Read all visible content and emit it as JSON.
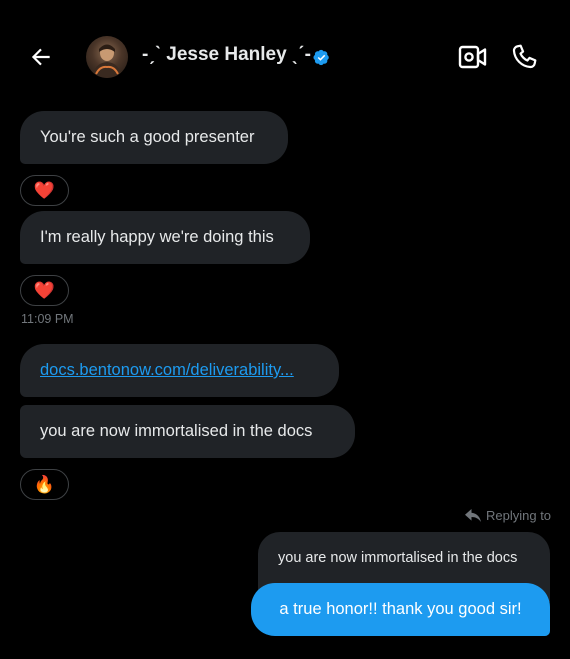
{
  "header": {
    "contact_name": "-ˏˋ Jesse Hanley ˎˊ-",
    "back_icon": "arrow-left-icon",
    "video_icon": "video-call-icon",
    "call_icon": "phone-icon",
    "verified_icon": "verified-badge-icon",
    "verified_color": "#1d9bf0"
  },
  "messages": [
    {
      "text": "You're such a good presenter",
      "reaction": "❤️"
    },
    {
      "text": "I'm really happy we're doing this",
      "reaction": "❤️"
    },
    {
      "timestamp": "11:09 PM"
    },
    {
      "link": "docs.bentonow.com/deliverability..."
    },
    {
      "text": "you are now immortalised in the docs",
      "reaction": "🔥"
    }
  ],
  "reply": {
    "label": "Replying to",
    "quoted_text": "you are now immortalised in the docs",
    "text": "a true honor!! thank you good sir!"
  },
  "colors": {
    "background": "#000000",
    "incoming_bubble": "#202327",
    "outgoing_bubble": "#1d9bf0",
    "link": "#1d9bf0",
    "muted_text": "#71767b"
  }
}
